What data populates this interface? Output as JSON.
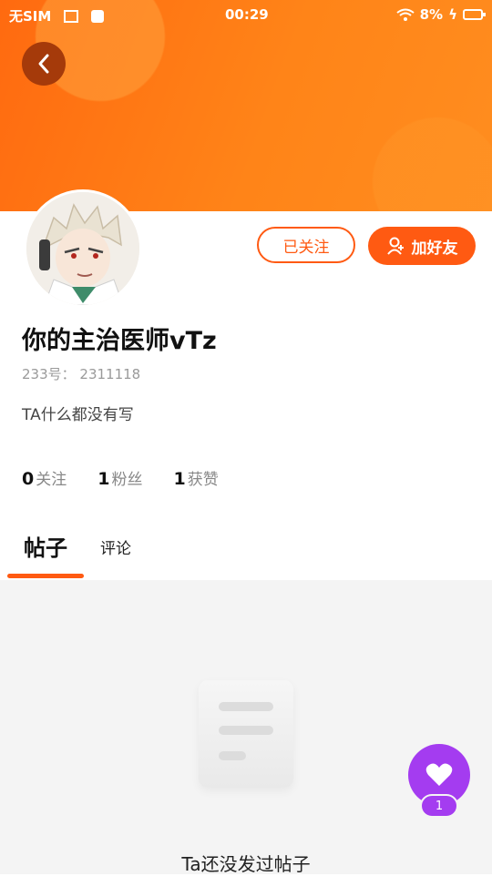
{
  "status_bar": {
    "carrier": "无SIM",
    "time": "00:29",
    "battery": "8%"
  },
  "profile": {
    "username": "你的主治医师vTz",
    "id_label": "233号：",
    "id_value": "2311118",
    "bio": "TA什么都没有写",
    "followed_label": "已关注",
    "add_friend_label": "加好友"
  },
  "stats": [
    {
      "value": "0",
      "label": "关注"
    },
    {
      "value": "1",
      "label": "粉丝"
    },
    {
      "value": "1",
      "label": "获赞"
    }
  ],
  "tabs": {
    "posts": "帖子",
    "comments": "评论"
  },
  "empty_state": {
    "text": "Ta还没发过帖子"
  },
  "fab": {
    "count": "1"
  },
  "colors": {
    "accent": "#ff5a12",
    "header_gradient_start": "#ff6a10",
    "header_gradient_end": "#ff8d1f",
    "fab": "#a43cf0"
  }
}
